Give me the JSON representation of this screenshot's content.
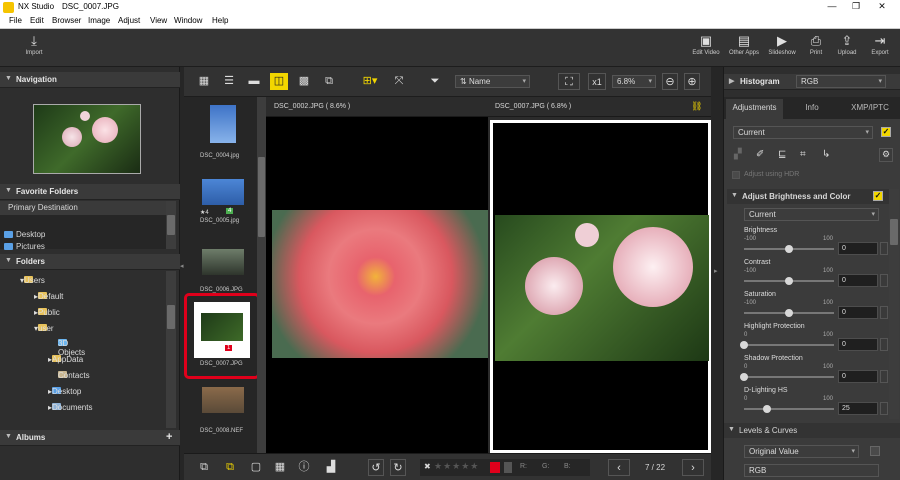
{
  "window": {
    "app_name": "NX Studio",
    "file_name": "DSC_0007.JPG",
    "minimize": "—",
    "maximize": "❐",
    "close": "✕"
  },
  "menu": [
    "File",
    "Edit",
    "Browser",
    "Image",
    "Adjust",
    "View",
    "Window",
    "Help"
  ],
  "toolbar": {
    "import": "Import",
    "edit_video": "Edit Video",
    "other_apps": "Other Apps",
    "slideshow": "Slideshow",
    "print": "Print",
    "upload": "Upload",
    "export": "Export"
  },
  "navigation": {
    "title": "Navigation"
  },
  "favorites": {
    "title": "Favorite Folders",
    "items": [
      "Primary Destination",
      "Desktop",
      "Pictures"
    ]
  },
  "folders": {
    "title": "Folders",
    "items": [
      "Users",
      "Default",
      "Public",
      "user",
      "3D Objects",
      "AppData",
      "Contacts",
      "Desktop",
      "Documents"
    ]
  },
  "albums": {
    "title": "Albums",
    "add": "+"
  },
  "view_toolbar": {
    "sort_label": "Name",
    "zoom_prefix": "x1",
    "zoom": "6.8%"
  },
  "filmstrip": {
    "items": [
      {
        "name": "DSC_0004.jpg"
      },
      {
        "name": "DSC_0005.jpg",
        "rating": "★4",
        "badge": "4"
      },
      {
        "name": "DSC_0006.JPG"
      },
      {
        "name": "DSC_0007.JPG",
        "badge": "1"
      },
      {
        "name": "DSC_0008.NEF"
      }
    ]
  },
  "viewer": {
    "left_title": "DSC_0002.JPG ( 8.6% )",
    "right_title": "DSC_0007.JPG ( 6.8% )"
  },
  "bottom": {
    "r": "R:",
    "g": "G:",
    "b": "B:",
    "page": "7 / 22",
    "prev": "‹",
    "next": "›"
  },
  "histogram": {
    "title": "Histogram",
    "channel": "RGB"
  },
  "tabs": [
    "Adjustments",
    "Info",
    "XMP/IPTC"
  ],
  "adjustments": {
    "preset": "Current",
    "hdr": "Adjust using HDR",
    "section": "Adjust Brightness and Color",
    "section_preset": "Current",
    "sliders": [
      {
        "label": "Brightness",
        "min": "-100",
        "max": "100",
        "value": "0",
        "level": 0.5
      },
      {
        "label": "Contrast",
        "min": "-100",
        "max": "100",
        "value": "0",
        "level": 0.5
      },
      {
        "label": "Saturation",
        "min": "-100",
        "max": "100",
        "value": "0",
        "level": 0.5
      },
      {
        "label": "Highlight Protection",
        "min": "0",
        "max": "100",
        "value": "0",
        "level": 0
      },
      {
        "label": "Shadow Protection",
        "min": "0",
        "max": "100",
        "value": "0",
        "level": 0
      },
      {
        "label": "D-Lighting HS",
        "min": "0",
        "max": "100",
        "value": "25",
        "level": 0.25
      }
    ],
    "levels_title": "Levels & Curves",
    "levels_preset": "Original Value",
    "levels_channel": "RGB"
  },
  "colors": {
    "accent": "#f2d600",
    "highlight": "#e0001b"
  }
}
